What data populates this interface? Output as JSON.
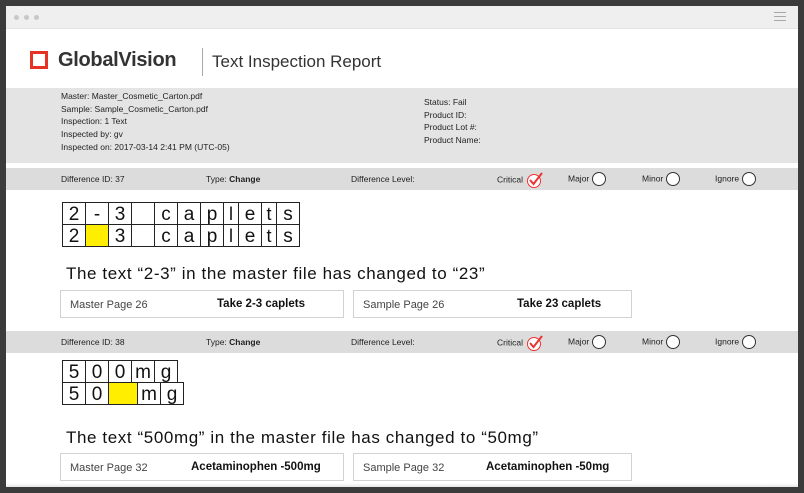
{
  "app": {
    "brand": "GlobalVision",
    "title": "Text Inspection Report"
  },
  "meta": {
    "master": "Master: Master_Cosmetic_Carton.pdf",
    "sample": "Sample: Sample_Cosmetic_Carton.pdf",
    "inspection": "Inspection: 1 Text",
    "inspected_by": "Inspected by: gv",
    "inspected_on": "Inspected on: 2017-03-14 2:41 PM (UTC-05)",
    "status": "Status: Fail",
    "product_id": "Product ID:",
    "product_lot": "Product Lot #:",
    "product_name": "Product Name:"
  },
  "levels": {
    "critical": "Critical",
    "major": "Major",
    "minor": "Minor",
    "ignore": "Ignore"
  },
  "diffs": [
    {
      "id": "Difference ID: 37",
      "type_label": "Type:",
      "type_value": "Change",
      "level_label": "Difference Level:",
      "master_chars": [
        "2",
        "-",
        "3",
        "",
        "c",
        "a",
        "p",
        "l",
        "e",
        "t",
        "s"
      ],
      "sample_chars": [
        "2",
        "",
        "3",
        "",
        "c",
        "a",
        "p",
        "l",
        "e",
        "t",
        "s"
      ],
      "sentence": "The text “2-3” in the master file has changed to “23”",
      "master_page": "Master Page 26",
      "master_text": "Take 2-3 caplets",
      "sample_page": "Sample Page 26",
      "sample_text": "Take 23 caplets"
    },
    {
      "id": "Difference ID: 38",
      "type_label": "Type:",
      "type_value": "Change",
      "level_label": "Difference Level:",
      "master_chars": [
        "5",
        "0",
        "0",
        "m",
        "g"
      ],
      "sample_chars": [
        "5",
        "0",
        "",
        "m",
        "g"
      ],
      "sentence": "The text “500mg” in the master file has changed to “50mg”",
      "master_page": "Master Page 32",
      "master_text": "Acetaminophen -500mg",
      "sample_page": "Sample Page 32",
      "sample_text": "Acetaminophen -50mg"
    }
  ],
  "colors": {
    "brand_red": "#e63323",
    "highlight": "#ffee00",
    "check_red": "#e33333"
  }
}
